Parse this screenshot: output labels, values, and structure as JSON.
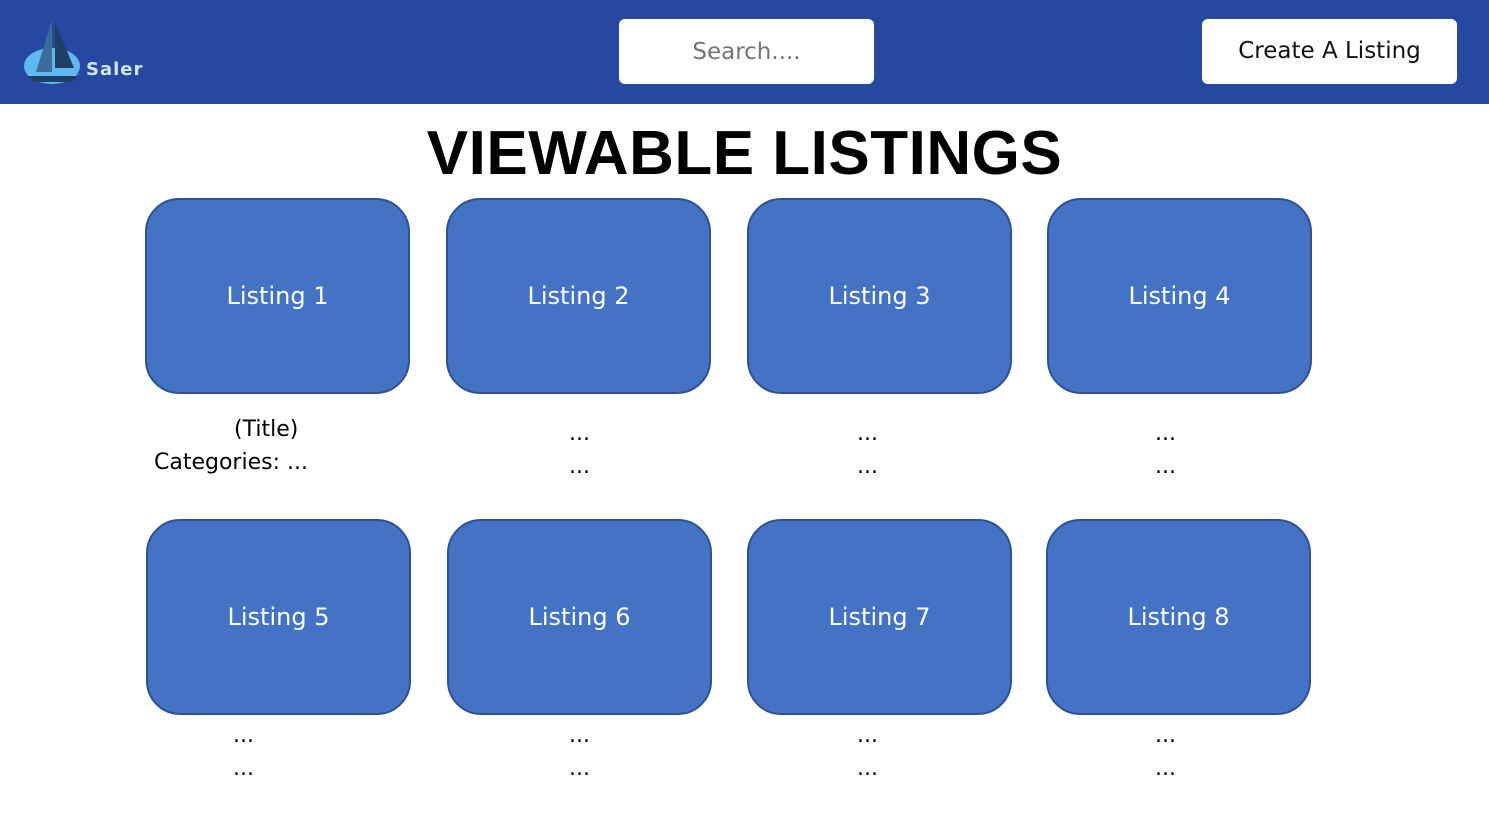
{
  "header": {
    "logo_text": "Saler",
    "search_placeholder": "Search....",
    "create_label": "Create A Listing",
    "colors": {
      "bar": "#2748a0",
      "card": "#4472c4",
      "card_border": "#2f528f"
    }
  },
  "page_title": "VIEWABLE LISTINGS",
  "listings": [
    {
      "label": "Listing 1",
      "line1": "(Title)",
      "line2": "Categories: ..."
    },
    {
      "label": "Listing 2",
      "line1": "...",
      "line2": "..."
    },
    {
      "label": "Listing 3",
      "line1": "...",
      "line2": "..."
    },
    {
      "label": "Listing 4",
      "line1": "...",
      "line2": "..."
    },
    {
      "label": "Listing 5",
      "line1": "...",
      "line2": "..."
    },
    {
      "label": "Listing 6",
      "line1": "...",
      "line2": "..."
    },
    {
      "label": "Listing 7",
      "line1": "...",
      "line2": "..."
    },
    {
      "label": "Listing 8",
      "line1": "...",
      "line2": "..."
    }
  ]
}
